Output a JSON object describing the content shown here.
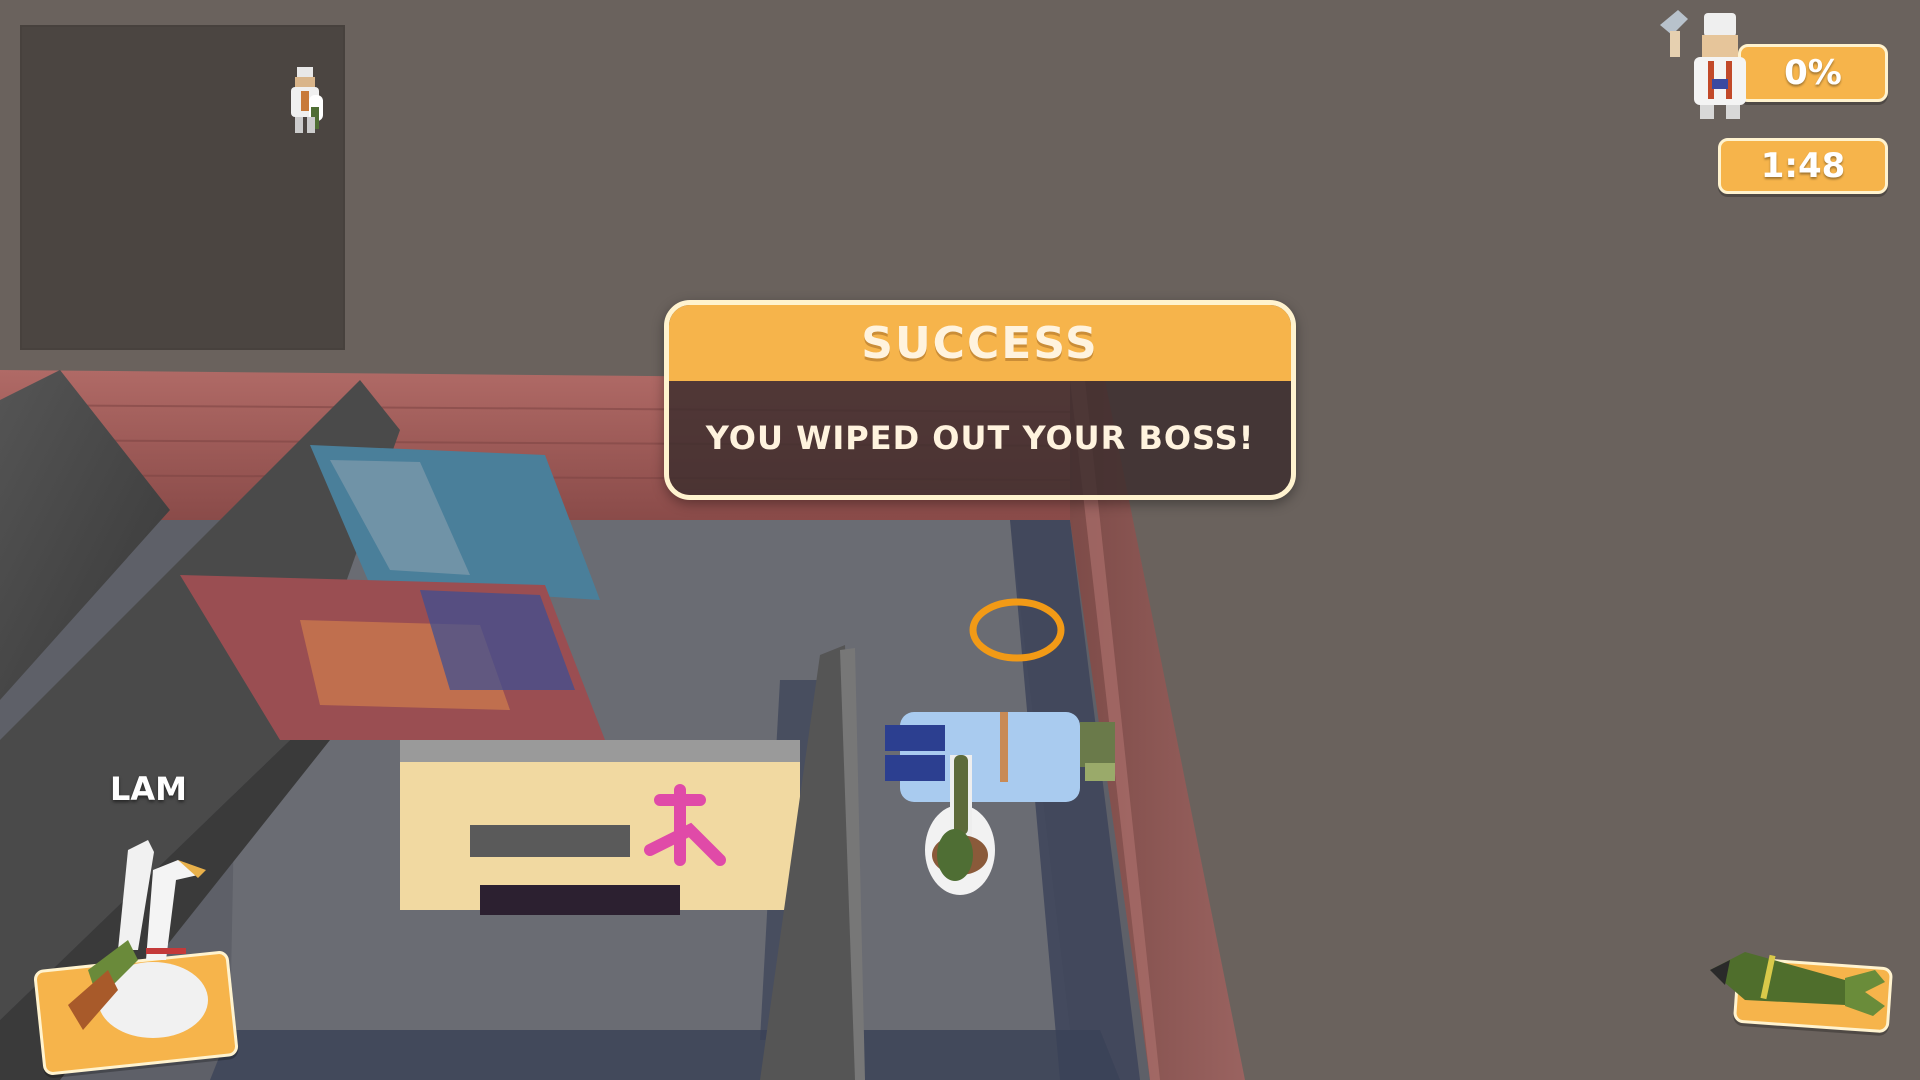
{
  "hud": {
    "progress_percent": "0%",
    "timer": "1:48",
    "player_name": "LAM"
  },
  "dialog": {
    "title": "SUCCESS",
    "message": "YOU WIPED OUT YOUR BOSS!"
  },
  "colors": {
    "accent": "#f6b44b",
    "accent_border": "#fff3cf",
    "dialog_body": "#3c2d2d",
    "ground": "#6a625d",
    "floor": "#5f6169",
    "wall_brick": "#a05c5c",
    "target_ring": "#f29a16"
  },
  "icons": {
    "boss_avatar": "chef-boss-icon",
    "player_avatar": "goose-icon",
    "weapon": "rocket-icon",
    "minimap_marker": "boss-marker-icon"
  }
}
